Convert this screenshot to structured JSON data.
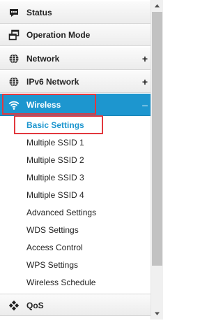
{
  "menu": {
    "status": {
      "label": "Status",
      "icon": "status-icon"
    },
    "operation_mode": {
      "label": "Operation Mode",
      "icon": "operation-mode-icon"
    },
    "network": {
      "label": "Network",
      "icon": "globe-icon",
      "expand": "+"
    },
    "ipv6_network": {
      "label": "IPv6 Network",
      "icon": "globe-icon",
      "expand": "+"
    },
    "wireless": {
      "label": "Wireless",
      "icon": "wifi-icon",
      "expand": "–",
      "sub_items": [
        "Basic Settings",
        "Multiple SSID 1",
        "Multiple SSID 2",
        "Multiple SSID 3",
        "Multiple SSID 4",
        "Advanced Settings",
        "WDS Settings",
        "Access Control",
        "WPS Settings",
        "Wireless Schedule"
      ]
    },
    "qos": {
      "label": "QoS",
      "icon": "qos-icon"
    }
  },
  "colors": {
    "accent": "#1d96cf",
    "highlight": "#e2383e"
  }
}
